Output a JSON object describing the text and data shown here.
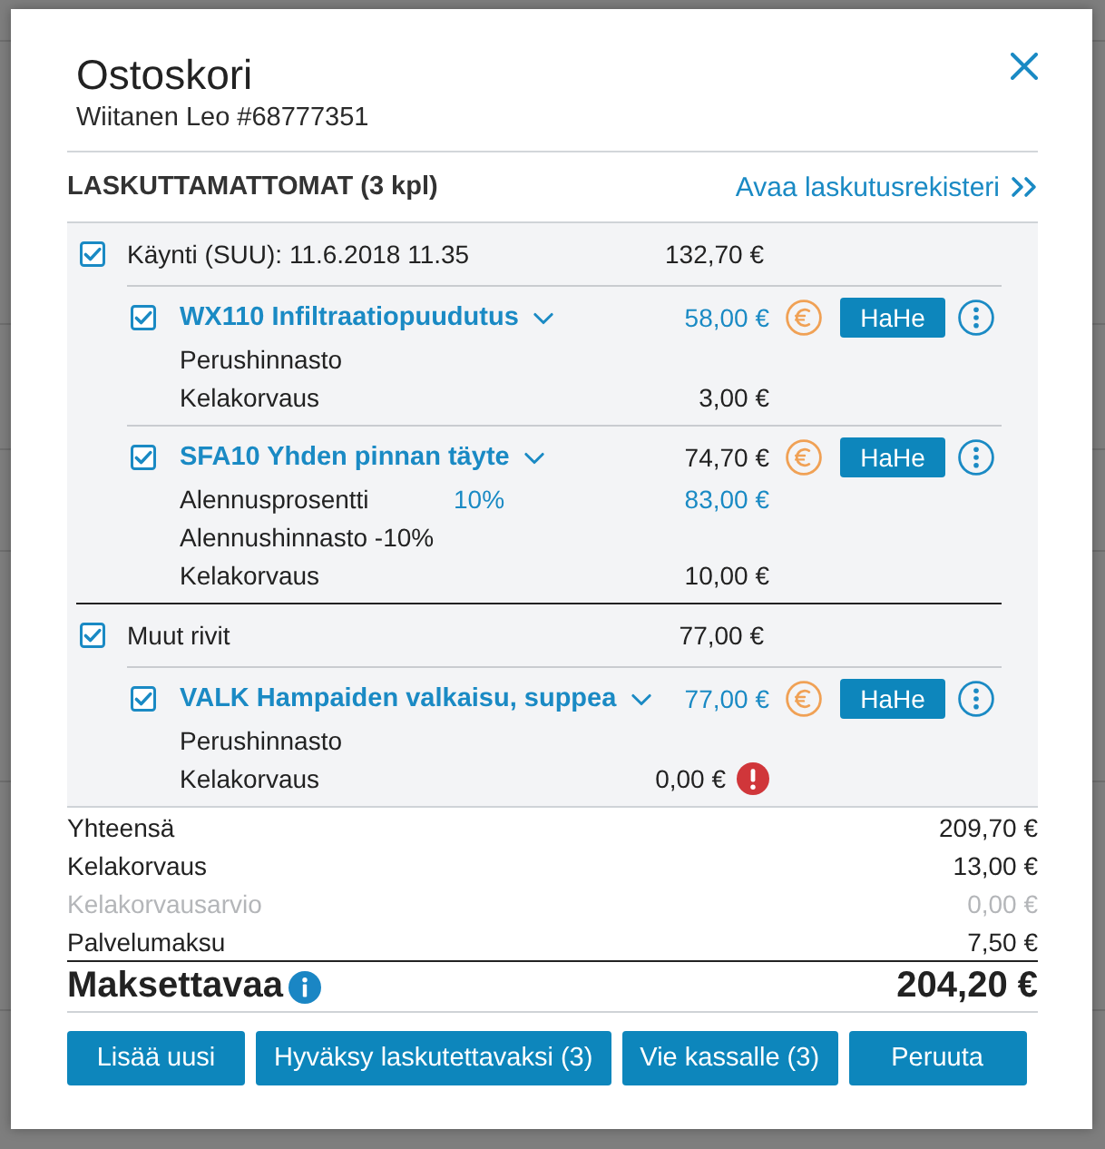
{
  "dialog": {
    "title": "Ostoskori",
    "subtitle": "Wiitanen Leo #68777351"
  },
  "section": {
    "heading": "LASKUTTAMATTOMAT (3 kpl)",
    "link": "Avaa laskutusrekisteri"
  },
  "groups": [
    {
      "label": "Käynti (SUU): 11.6.2018 11.35",
      "amount": "132,70 €",
      "checked": true,
      "items": [
        {
          "title": "WX110 Infiltraatiopuudutus",
          "checked": true,
          "price": "58,00 €",
          "price_highlighted": true,
          "button": "HaHe",
          "details": [
            {
              "label": "Perushinnasto",
              "warning": false
            },
            {
              "label": "Kelakorvaus",
              "amount": "3,00 €",
              "amount_highlighted": false,
              "warning": false
            }
          ]
        },
        {
          "title": "SFA10 Yhden pinnan täyte",
          "checked": true,
          "price": "74,70 €",
          "price_highlighted": false,
          "button": "HaHe",
          "details": [
            {
              "label": "Alennusprosentti",
              "value": "10%",
              "amount": "83,00 €",
              "amount_highlighted": true,
              "warning": false
            },
            {
              "label": "Alennushinnasto -10%",
              "warning": false
            },
            {
              "label": "Kelakorvaus",
              "amount": "10,00 €",
              "amount_highlighted": false,
              "warning": false
            }
          ]
        }
      ]
    },
    {
      "label": "Muut rivit",
      "amount": "77,00 €",
      "checked": true,
      "items": [
        {
          "title": "VALK Hampaiden valkaisu, suppea",
          "checked": true,
          "price": "77,00 €",
          "price_highlighted": true,
          "button": "HaHe",
          "details": [
            {
              "label": "Perushinnasto",
              "warning": false
            },
            {
              "label": "Kelakorvaus",
              "amount": "0,00 €",
              "amount_highlighted": false,
              "warning": true
            }
          ]
        }
      ]
    }
  ],
  "totals": [
    {
      "label": "Yhteensä",
      "amount": "209,70 €",
      "disabled": false
    },
    {
      "label": "Kelakorvaus",
      "amount": "13,00 €",
      "disabled": false
    },
    {
      "label": "Kelakorvausarvio",
      "amount": "0,00 €",
      "disabled": true
    },
    {
      "label": "Palvelumaksu",
      "amount": "7,50 €",
      "disabled": false
    }
  ],
  "grand_total": {
    "label": "Maksettavaa",
    "amount": "204,20 €"
  },
  "buttons": [
    "Lisää uusi",
    "Hyväksy laskutettavaksi (3)",
    "Vie kassalle (3)",
    "Peruuta"
  ]
}
